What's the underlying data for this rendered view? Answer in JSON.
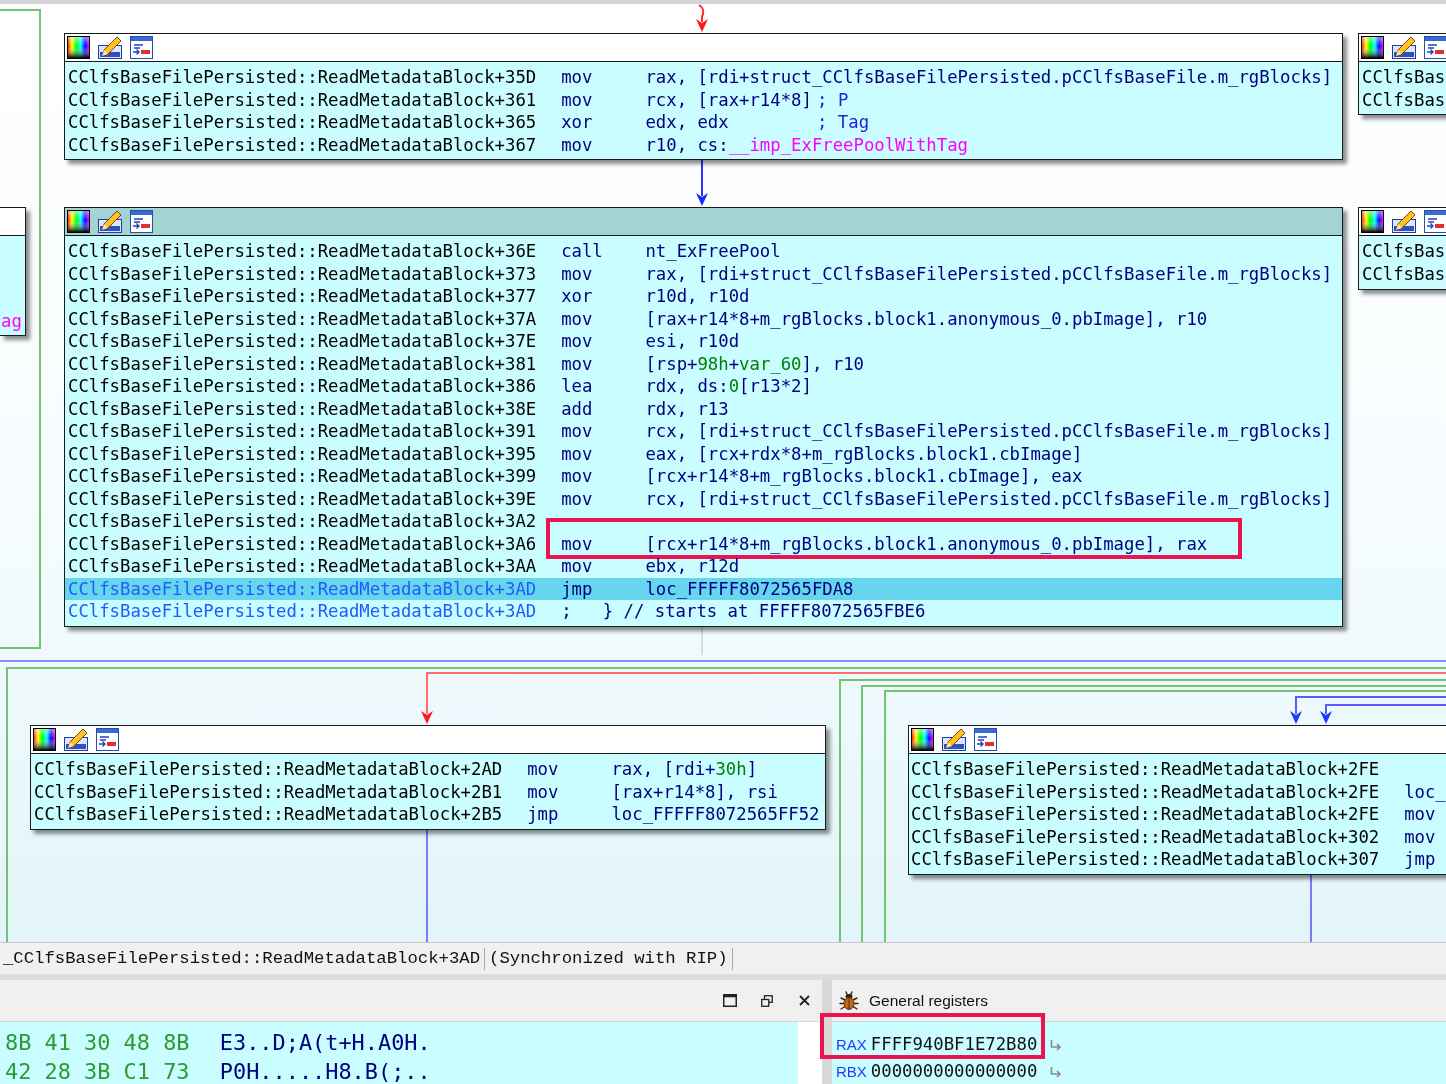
{
  "graph": {
    "blocks": [
      {
        "selected": false,
        "lines": [
          {
            "address": "CClfsBaseFilePersisted::ReadMetadataBlock+35D",
            "mnemonic": "mov",
            "operands": [
              {
                "kind": "plain",
                "text": "rax, [rdi+struct_CClfsBaseFilePersisted.pCClfsBaseFile.m_rgBlocks]"
              }
            ],
            "current": false,
            "selected": false,
            "boxed": false
          },
          {
            "address": "CClfsBaseFilePersisted::ReadMetadataBlock+361",
            "mnemonic": "mov",
            "operands": [
              {
                "kind": "plain",
                "text": "rcx, [rax+r14*8]"
              }
            ],
            "comment": "; P",
            "current": false,
            "selected": false,
            "boxed": false
          },
          {
            "address": "CClfsBaseFilePersisted::ReadMetadataBlock+365",
            "mnemonic": "xor",
            "operands": [
              {
                "kind": "plain",
                "text": "edx, edx"
              }
            ],
            "comment": "; Tag",
            "current": false,
            "selected": false,
            "boxed": false
          },
          {
            "address": "CClfsBaseFilePersisted::ReadMetadataBlock+367",
            "mnemonic": "mov",
            "operands": [
              {
                "kind": "plain",
                "text": "r10, cs:"
              },
              {
                "kind": "import",
                "text": "__imp_ExFreePoolWithTag"
              }
            ],
            "current": false,
            "selected": false,
            "boxed": false
          }
        ]
      },
      {
        "selected": false,
        "lines": [
          {
            "address": "CClfsBas",
            "current": false,
            "selected": false,
            "boxed": false
          },
          {
            "address": "CClfsBas",
            "current": false,
            "selected": false,
            "boxed": false
          }
        ]
      },
      {
        "selected": false,
        "lines": [
          {
            "operands": [
              {
                "kind": "import",
                "text": "ag"
              }
            ],
            "selected": false,
            "boxed": false
          }
        ]
      },
      {
        "selected": true,
        "lines": [
          {
            "address": "CClfsBaseFilePersisted::ReadMetadataBlock+36E",
            "mnemonic": "call",
            "operands": [
              {
                "kind": "plain",
                "text": "nt_ExFreePool"
              }
            ],
            "current": false,
            "selected": false,
            "boxed": false
          },
          {
            "address": "CClfsBaseFilePersisted::ReadMetadataBlock+373",
            "mnemonic": "mov",
            "operands": [
              {
                "kind": "plain",
                "text": "rax, [rdi+struct_CClfsBaseFilePersisted.pCClfsBaseFile.m_rgBlocks]"
              }
            ],
            "current": false,
            "selected": false,
            "boxed": false
          },
          {
            "address": "CClfsBaseFilePersisted::ReadMetadataBlock+377",
            "mnemonic": "xor",
            "operands": [
              {
                "kind": "plain",
                "text": "r10d, r10d"
              }
            ],
            "current": false,
            "selected": false,
            "boxed": false
          },
          {
            "address": "CClfsBaseFilePersisted::ReadMetadataBlock+37A",
            "mnemonic": "mov",
            "operands": [
              {
                "kind": "plain",
                "text": "[rax+r14*8+m_rgBlocks.block1.anonymous_0.pbImage], r10"
              }
            ],
            "current": false,
            "selected": false,
            "boxed": false
          },
          {
            "address": "CClfsBaseFilePersisted::ReadMetadataBlock+37E",
            "mnemonic": "mov",
            "operands": [
              {
                "kind": "plain",
                "text": "esi, r10d"
              }
            ],
            "current": false,
            "selected": false,
            "boxed": false
          },
          {
            "address": "CClfsBaseFilePersisted::ReadMetadataBlock+381",
            "mnemonic": "mov",
            "operands": [
              {
                "kind": "plain",
                "text": "[rsp+"
              },
              {
                "kind": "number",
                "text": "98h"
              },
              {
                "kind": "plain",
                "text": "+"
              },
              {
                "kind": "number",
                "text": "var_60"
              },
              {
                "kind": "plain",
                "text": "], r10"
              }
            ],
            "current": false,
            "selected": false,
            "boxed": false
          },
          {
            "address": "CClfsBaseFilePersisted::ReadMetadataBlock+386",
            "mnemonic": "lea",
            "operands": [
              {
                "kind": "plain",
                "text": "rdx, ds:"
              },
              {
                "kind": "number",
                "text": "0"
              },
              {
                "kind": "plain",
                "text": "[r13*2]"
              }
            ],
            "current": false,
            "selected": false,
            "boxed": false
          },
          {
            "address": "CClfsBaseFilePersisted::ReadMetadataBlock+38E",
            "mnemonic": "add",
            "operands": [
              {
                "kind": "plain",
                "text": "rdx, r13"
              }
            ],
            "current": false,
            "selected": false,
            "boxed": false
          },
          {
            "address": "CClfsBaseFilePersisted::ReadMetadataBlock+391",
            "mnemonic": "mov",
            "operands": [
              {
                "kind": "plain",
                "text": "rcx, [rdi+struct_CClfsBaseFilePersisted.pCClfsBaseFile.m_rgBlocks]"
              }
            ],
            "current": false,
            "selected": false,
            "boxed": false
          },
          {
            "address": "CClfsBaseFilePersisted::ReadMetadataBlock+395",
            "mnemonic": "mov",
            "operands": [
              {
                "kind": "plain",
                "text": "eax, [rcx+rdx*8+m_rgBlocks.block1.cbImage]"
              }
            ],
            "current": false,
            "selected": false,
            "boxed": false
          },
          {
            "address": "CClfsBaseFilePersisted::ReadMetadataBlock+399",
            "mnemonic": "mov",
            "operands": [
              {
                "kind": "plain",
                "text": "[rcx+r14*8+m_rgBlocks.block1.cbImage], eax"
              }
            ],
            "current": false,
            "selected": false,
            "boxed": false
          },
          {
            "address": "CClfsBaseFilePersisted::ReadMetadataBlock+39E",
            "mnemonic": "mov",
            "operands": [
              {
                "kind": "plain",
                "text": "rcx, [rdi+struct_CClfsBaseFilePersisted.pCClfsBaseFile.m_rgBlocks]"
              }
            ],
            "current": false,
            "selected": false,
            "boxed": false
          },
          {
            "address": "CClfsBaseFilePersisted::ReadMetadataBlock+3A2",
            "current": false,
            "selected": false,
            "boxed": false
          },
          {
            "address": "CClfsBaseFilePersisted::ReadMetadataBlock+3A6",
            "mnemonic": "mov",
            "operands": [
              {
                "kind": "plain",
                "text": "[rcx+r14*8+m_rgBlocks.block1.anonymous_0.pbImage], rax"
              }
            ],
            "current": false,
            "selected": false,
            "boxed": true
          },
          {
            "address": "CClfsBaseFilePersisted::ReadMetadataBlock+3AA",
            "mnemonic": "mov",
            "operands": [
              {
                "kind": "plain",
                "text": "ebx, r12d"
              }
            ],
            "current": false,
            "selected": false,
            "boxed": false
          },
          {
            "address": "CClfsBaseFilePersisted::ReadMetadataBlock+3AD",
            "mnemonic": "jmp",
            "operands": [
              {
                "kind": "plain",
                "text": "loc_FFFFF8072565FDA8"
              }
            ],
            "current": true,
            "selected": true,
            "boxed": false
          },
          {
            "address": "CClfsBaseFilePersisted::ReadMetadataBlock+3AD",
            "comment": ";   } // starts at FFFFF8072565FBE6",
            "current": true,
            "selected": false,
            "boxed": false
          }
        ]
      },
      {
        "selected": false,
        "lines": [
          {
            "address": "CClfsBas",
            "current": false,
            "selected": false,
            "boxed": false
          },
          {
            "address": "CClfsBas",
            "current": false,
            "selected": false,
            "boxed": false
          }
        ]
      },
      {
        "selected": false,
        "lines": [
          {
            "address": "CClfsBaseFilePersisted::ReadMetadataBlock+2AD",
            "mnemonic": "mov",
            "operands": [
              {
                "kind": "plain",
                "text": "rax, [rdi+"
              },
              {
                "kind": "number",
                "text": "30h"
              },
              {
                "kind": "plain",
                "text": "]"
              }
            ],
            "current": false,
            "selected": false,
            "boxed": false
          },
          {
            "address": "CClfsBaseFilePersisted::ReadMetadataBlock+2B1",
            "mnemonic": "mov",
            "operands": [
              {
                "kind": "plain",
                "text": "[rax+r14*8], rsi"
              }
            ],
            "current": false,
            "selected": false,
            "boxed": false
          },
          {
            "address": "CClfsBaseFilePersisted::ReadMetadataBlock+2B5",
            "mnemonic": "jmp",
            "operands": [
              {
                "kind": "plain",
                "text": "loc_FFFFF8072565FF52"
              }
            ],
            "current": false,
            "selected": false,
            "boxed": false
          }
        ]
      },
      {
        "selected": false,
        "lines": [
          {
            "address": "CClfsBaseFilePersisted::ReadMetadataBlock+2FE",
            "current": false,
            "selected": false,
            "boxed": false
          },
          {
            "address": "CClfsBaseFilePersisted::ReadMetadataBlock+2FE",
            "mnemonic": "loc_",
            "current": false,
            "selected": false,
            "boxed": false
          },
          {
            "address": "CClfsBaseFilePersisted::ReadMetadataBlock+2FE",
            "mnemonic": "mov",
            "current": false,
            "selected": false,
            "boxed": false
          },
          {
            "address": "CClfsBaseFilePersisted::ReadMetadataBlock+302",
            "mnemonic": "mov",
            "current": false,
            "selected": false,
            "boxed": false
          },
          {
            "address": "CClfsBaseFilePersisted::ReadMetadataBlock+307",
            "mnemonic": "jmp",
            "current": false,
            "selected": false,
            "boxed": false
          }
        ]
      }
    ]
  },
  "status_bar": {
    "location": "_CClfsBaseFilePersisted::ReadMetadataBlock+3AD",
    "sync": "(Synchronized with RIP)"
  },
  "hex_view": {
    "rows": [
      {
        "bytes": "8B 41 30 48 8B",
        "ascii": "E3..D;A(t+H.A0H."
      },
      {
        "bytes": "42 28 3B C1 73",
        "ascii": "P0H.....H8.B(;.."
      }
    ]
  },
  "registers": {
    "title": "General registers",
    "items": [
      {
        "name": "RAX",
        "value": "FFFF940BF1E72B80",
        "boxed": true
      },
      {
        "name": "RBX",
        "value": "0000000000000000",
        "boxed": false
      }
    ]
  }
}
